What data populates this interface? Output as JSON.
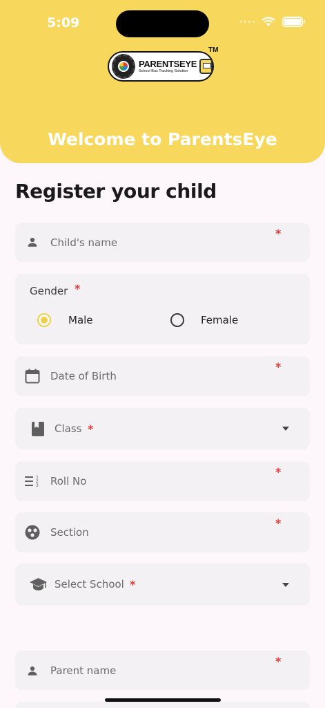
{
  "status_bar": {
    "time": "5:09"
  },
  "header": {
    "logo_brand": "PARENTSEYE",
    "logo_tagline": "School Bus Tracking Solution",
    "trademark": "TM",
    "welcome": "Welcome to ParentsEye"
  },
  "form": {
    "title": "Register your child",
    "required_mark": "*",
    "child_name_placeholder": "Child's name",
    "gender_label": "Gender",
    "gender_options": [
      {
        "label": "Male",
        "selected": true
      },
      {
        "label": "Female",
        "selected": false
      }
    ],
    "dob_placeholder": "Date of Birth",
    "class_label": "Class",
    "roll_placeholder": "Roll No",
    "section_placeholder": "Section",
    "school_label": "Select School",
    "parent_name_placeholder": "Parent name"
  },
  "colors": {
    "header_yellow": "#f7d85c",
    "accent_yellow": "#f2cf4a",
    "required_red": "#e53935",
    "field_bg": "#f3f1f3"
  },
  "icons": {
    "child_name": "person-icon",
    "dob": "calendar-icon",
    "class": "book-icon",
    "roll": "numbered-list-icon",
    "section": "section-icon",
    "school": "graduation-cap-icon",
    "parent": "person-icon"
  }
}
